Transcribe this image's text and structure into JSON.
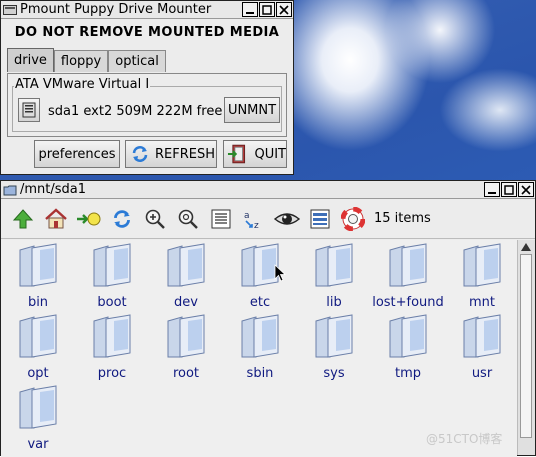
{
  "pmount": {
    "title": "Pmount Puppy Drive Mounter",
    "warning": "DO NOT REMOVE MOUNTED MEDIA",
    "tabs": [
      "drive",
      "floppy",
      "optical"
    ],
    "group_label": "ATA VMware Virtual I",
    "drive_info": "sda1 ext2 509M 222M free",
    "unmount_label": "UNMNT",
    "preferences_label": "preferences",
    "refresh_label": "REFRESH",
    "quit_label": "QUIT"
  },
  "filer": {
    "title": "/mnt/sda1",
    "items_count": "15 items",
    "items": [
      "bin",
      "boot",
      "dev",
      "etc",
      "lib",
      "lost+found",
      "mnt",
      "opt",
      "proc",
      "root",
      "sbin",
      "sys",
      "tmp",
      "usr",
      "var"
    ]
  },
  "watermark": "@51CTO博客",
  "colors": {
    "desktop": "#2b56ad",
    "label": "#101a80",
    "window": "#ececec"
  }
}
